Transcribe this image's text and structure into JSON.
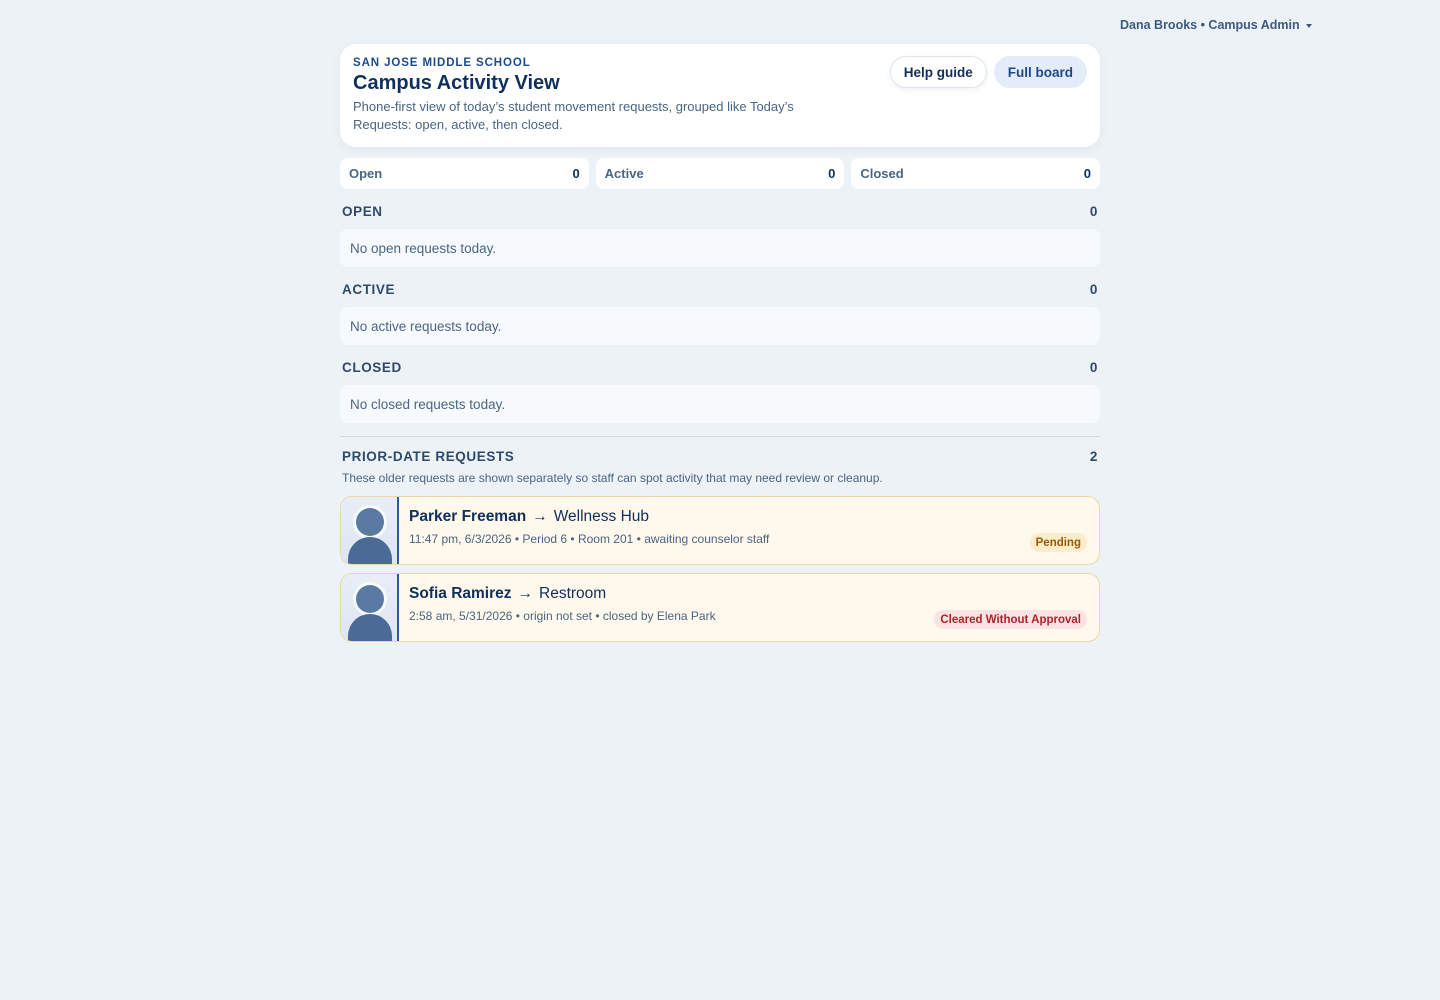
{
  "user_menu": {
    "label": "Dana Brooks • Campus Admin"
  },
  "header": {
    "school": "SAN JOSE MIDDLE SCHOOL",
    "title": "Campus Activity View",
    "subtitle": "Phone-first view of today’s student movement requests, grouped like Today’s Requests: open, active, then closed.",
    "help_label": "Help guide",
    "board_label": "Full board"
  },
  "counts": [
    {
      "label": "Open",
      "value": "0"
    },
    {
      "label": "Active",
      "value": "0"
    },
    {
      "label": "Closed",
      "value": "0"
    }
  ],
  "sections": [
    {
      "title": "OPEN",
      "count": "0",
      "empty": "No open requests today."
    },
    {
      "title": "ACTIVE",
      "count": "0",
      "empty": "No active requests today."
    },
    {
      "title": "CLOSED",
      "count": "0",
      "empty": "No closed requests today."
    }
  ],
  "prior": {
    "title": "PRIOR-DATE REQUESTS",
    "count": "2",
    "note": "These older requests are shown separately so staff can spot activity that may need review or cleanup.",
    "requests": [
      {
        "student": "Parker Freeman",
        "arrow": "→",
        "destination": "Wellness Hub",
        "meta": "11:47 pm, 6/3/2026 • Period 6 • Room 201 • awaiting counselor staff",
        "status": "Pending"
      },
      {
        "student": "Sofia Ramirez",
        "arrow": "→",
        "destination": "Restroom",
        "meta": "2:58 am, 5/31/2026 • origin not set • closed by Elena Park",
        "status": "Cleared Without Approval"
      }
    ]
  },
  "colors": {
    "background": "#edf2f7",
    "primary_text": "#0f2f5c",
    "pending_badge": "#fbedc9",
    "cleared_badge": "#fce2e2",
    "request_card": "#fff8ec"
  }
}
